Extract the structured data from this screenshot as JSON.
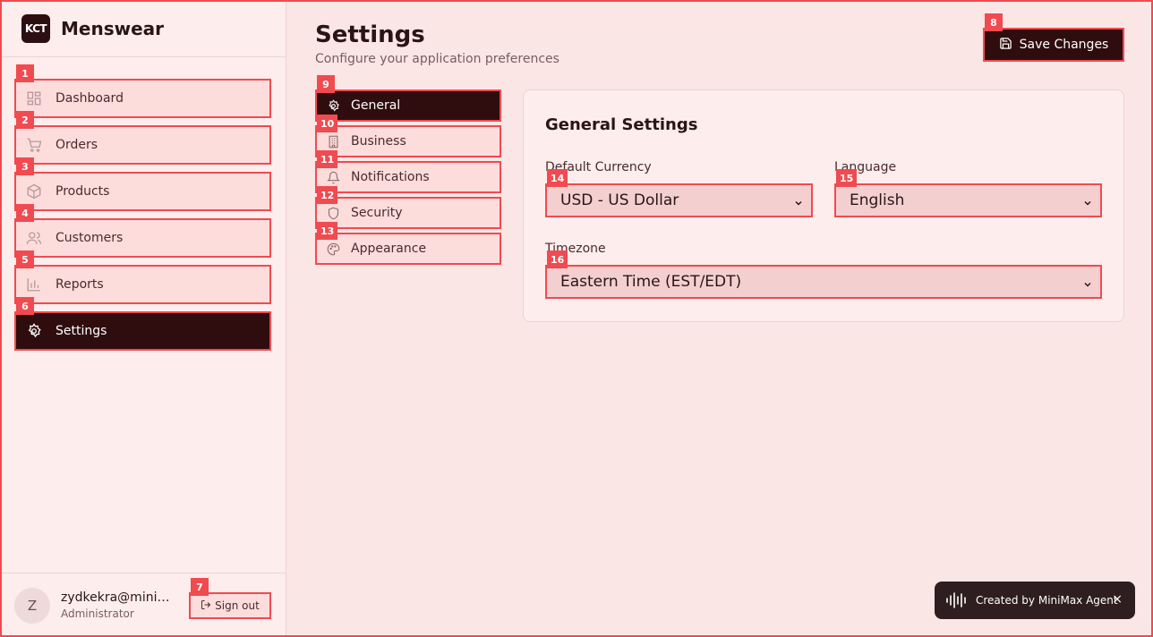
{
  "brand": {
    "logo_text": "KCT",
    "name": "Menswear"
  },
  "sidebar": {
    "items": [
      {
        "label": "Dashboard",
        "badge": "1",
        "icon": "dashboard-icon"
      },
      {
        "label": "Orders",
        "badge": "2",
        "icon": "cart-icon"
      },
      {
        "label": "Products",
        "badge": "3",
        "icon": "box-icon"
      },
      {
        "label": "Customers",
        "badge": "4",
        "icon": "users-icon"
      },
      {
        "label": "Reports",
        "badge": "5",
        "icon": "bar-chart-icon"
      },
      {
        "label": "Settings",
        "badge": "6",
        "icon": "gear-icon",
        "active": true
      }
    ]
  },
  "user": {
    "avatar_initial": "Z",
    "email": "zydkekra@minimax.com",
    "role": "Administrator",
    "signout_label": "Sign out",
    "signout_badge": "7"
  },
  "header": {
    "title": "Settings",
    "subtitle": "Configure your application preferences",
    "save_label": "Save Changes",
    "save_badge": "8"
  },
  "tabs": [
    {
      "label": "General",
      "badge": "9",
      "icon": "gear-icon",
      "active": true
    },
    {
      "label": "Business",
      "badge": "10",
      "icon": "building-icon"
    },
    {
      "label": "Notifications",
      "badge": "11",
      "icon": "bell-icon"
    },
    {
      "label": "Security",
      "badge": "12",
      "icon": "shield-icon"
    },
    {
      "label": "Appearance",
      "badge": "13",
      "icon": "palette-icon"
    }
  ],
  "general": {
    "title": "General Settings",
    "currency_label": "Default Currency",
    "currency_value": "USD - US Dollar",
    "currency_badge": "14",
    "language_label": "Language",
    "language_value": "English",
    "language_badge": "15",
    "timezone_label": "Timezone",
    "timezone_value": "Eastern Time (EST/EDT)",
    "timezone_badge": "16"
  },
  "toast": {
    "text": "Created by MiniMax Agent",
    "close": "×"
  },
  "colors": {
    "accent": "#ef4b50",
    "dark": "#2f0d0f",
    "background": "#fbe6e6"
  }
}
